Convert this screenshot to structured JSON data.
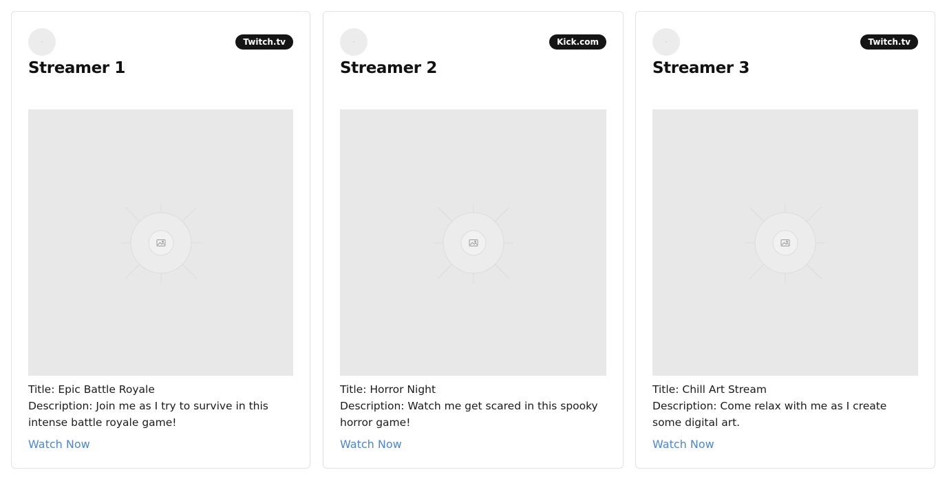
{
  "cards": [
    {
      "name": "Streamer 1",
      "platform": "Twitch.tv",
      "title_text": "Title: Epic Battle Royale",
      "description_text": "Description: Join me as I try to survive in this intense battle royale game!",
      "link_label": "Watch Now",
      "thumbnail_icon": "image-placeholder-icon"
    },
    {
      "name": "Streamer 2",
      "platform": "Kick.com",
      "title_text": "Title: Horror Night",
      "description_text": "Description: Watch me get scared in this spooky horror game!",
      "link_label": "Watch Now",
      "thumbnail_icon": "image-placeholder-icon"
    },
    {
      "name": "Streamer 3",
      "platform": "Twitch.tv",
      "title_text": "Title: Chill Art Stream",
      "description_text": "Description: Come relax with me as I create some digital art.",
      "link_label": "Watch Now",
      "thumbnail_icon": "image-placeholder-icon"
    }
  ],
  "colors": {
    "badge_bg": "#151515",
    "link": "#4a86d6",
    "thumbnail_bg": "#e8e8e8",
    "card_border": "#e2e2e2"
  }
}
